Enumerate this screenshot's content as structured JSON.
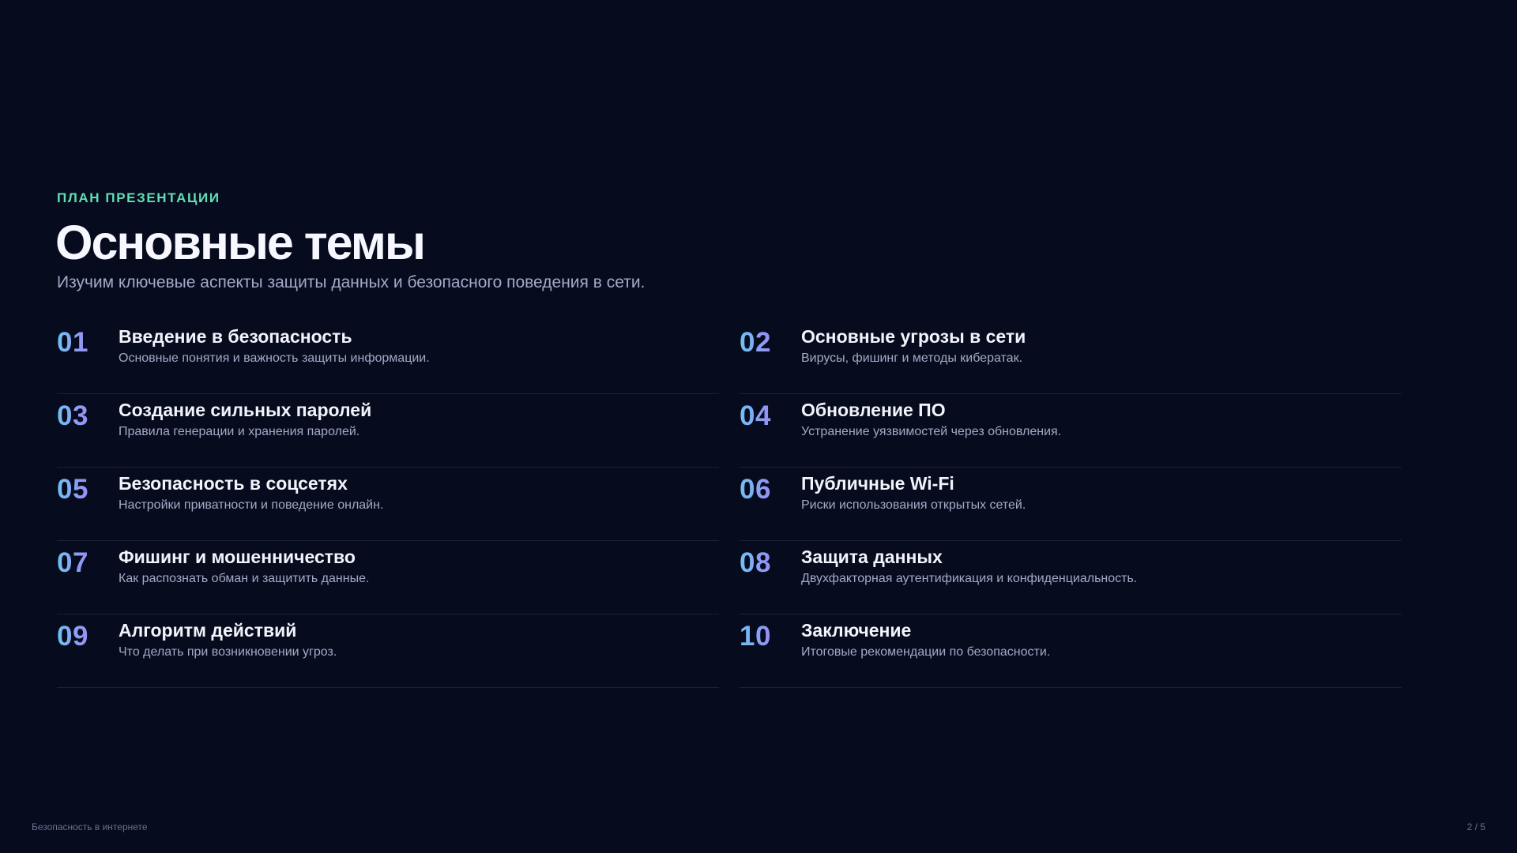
{
  "header": {
    "kicker": "ПЛАН ПРЕЗЕНТАЦИИ",
    "title": "Основные темы",
    "subtitle": "Изучим ключевые аспекты защиты данных и безопасного поведения в сети."
  },
  "topics": [
    {
      "number": "01",
      "title": "Введение в безопасность",
      "description": "Основные понятия и важность защиты информации."
    },
    {
      "number": "02",
      "title": "Основные угрозы в сети",
      "description": "Вирусы, фишинг и методы кибератак."
    },
    {
      "number": "03",
      "title": "Создание сильных паролей",
      "description": "Правила генерации и хранения паролей."
    },
    {
      "number": "04",
      "title": "Обновление ПО",
      "description": "Устранение уязвимостей через обновления."
    },
    {
      "number": "05",
      "title": "Безопасность в соцсетях",
      "description": "Настройки приватности и поведение онлайн."
    },
    {
      "number": "06",
      "title": "Публичные Wi-Fi",
      "description": "Риски использования открытых сетей."
    },
    {
      "number": "07",
      "title": "Фишинг и мошенничество",
      "description": "Как распознать обман и защитить данные."
    },
    {
      "number": "08",
      "title": "Защита данных",
      "description": "Двухфакторная аутентификация и конфиденциальность."
    },
    {
      "number": "09",
      "title": "Алгоритм действий",
      "description": "Что делать при возникновении угроз."
    },
    {
      "number": "10",
      "title": "Заключение",
      "description": "Итоговые рекомендации по безопасности."
    }
  ],
  "footer": {
    "presentation_name": "Безопасность в интернете",
    "page_indicator": "2 / 5"
  },
  "colors": {
    "background": "#070b1e",
    "accent_kicker": "#5fe0b6",
    "number_gradient_start": "#6fc2f2",
    "number_gradient_end": "#9a8cf5"
  }
}
